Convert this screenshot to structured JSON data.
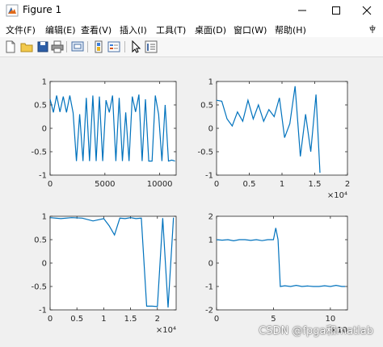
{
  "window": {
    "title": "Figure 1"
  },
  "menu": {
    "items": [
      {
        "label": "文件(F)",
        "underline": "F"
      },
      {
        "label": "编辑(E)",
        "underline": "E"
      },
      {
        "label": "查看(V)",
        "underline": "V"
      },
      {
        "label": "插入(I)",
        "underline": "I"
      },
      {
        "label": "工具(T)",
        "underline": "T"
      },
      {
        "label": "桌面(D)",
        "underline": "D"
      },
      {
        "label": "窗口(W)",
        "underline": "W"
      },
      {
        "label": "帮助(H)",
        "underline": "H"
      }
    ]
  },
  "toolbar": {
    "buttons": [
      "new-figure-icon",
      "open-file-icon",
      "save-icon",
      "print-icon",
      "link-plot-icon",
      "insert-colorbar-icon",
      "insert-legend-icon",
      "select-arrow-icon",
      "property-inspector-icon"
    ]
  },
  "colors": {
    "line": "#0072bd",
    "axes_bg": "#ffffff",
    "figure_bg": "#f0f0f0"
  },
  "chart_data": [
    {
      "type": "line",
      "xlim": [
        0,
        11500
      ],
      "ylim": [
        -1,
        1
      ],
      "xticks": [
        0,
        5000,
        10000
      ],
      "xtick_labels": [
        "0",
        "5000",
        "10000"
      ],
      "yticks": [
        -1,
        -0.5,
        0,
        0.5,
        1
      ],
      "ytick_labels": [
        "-1",
        "-0.5",
        "0",
        "0.5",
        "1"
      ],
      "exponent_label": "",
      "grid": false,
      "series": [
        {
          "x": [
            0,
            300,
            600,
            900,
            1200,
            1500,
            1800,
            2100,
            2400,
            2700,
            3000,
            3300,
            3600,
            3900,
            4200,
            4500,
            4800,
            5100,
            5400,
            5700,
            6000,
            6300,
            6600,
            6900,
            7200,
            7500,
            7800,
            8100,
            8400,
            8700,
            9000,
            9300,
            9600,
            9900,
            10200,
            10500,
            10800,
            11100,
            11400
          ],
          "y": [
            0.62,
            0.34,
            0.7,
            0.35,
            0.68,
            0.34,
            0.7,
            0.33,
            -0.7,
            0.3,
            -0.7,
            0.65,
            -0.7,
            0.7,
            -0.7,
            0.68,
            -0.7,
            0.6,
            0.34,
            0.7,
            -0.7,
            0.65,
            -0.7,
            0.34,
            -0.7,
            0.68,
            0.35,
            0.72,
            -0.7,
            0.62,
            -0.7,
            -0.7,
            0.7,
            0.3,
            -0.7,
            0.5,
            -0.7,
            -0.68,
            -0.7
          ]
        }
      ]
    },
    {
      "type": "line",
      "xlim": [
        0,
        20000
      ],
      "ylim": [
        -1,
        1
      ],
      "xticks": [
        0,
        5000,
        10000,
        15000,
        20000
      ],
      "xtick_labels": [
        "0",
        "0.5",
        "1",
        "1.5",
        "2"
      ],
      "yticks": [
        -1,
        -0.5,
        0,
        0.5,
        1
      ],
      "ytick_labels": [
        "-1",
        "-0.5",
        "0",
        "0.5",
        "1"
      ],
      "exponent_label": "×10⁴",
      "grid": false,
      "series": [
        {
          "x": [
            0,
            800,
            1600,
            2400,
            3200,
            4000,
            4800,
            5600,
            6400,
            7200,
            8000,
            8800,
            9600,
            10400,
            11200,
            12000,
            12800,
            13600,
            14400,
            15200,
            15800
          ],
          "y": [
            0.6,
            0.58,
            0.2,
            0.05,
            0.35,
            0.15,
            0.6,
            0.2,
            0.5,
            0.15,
            0.4,
            0.25,
            0.65,
            -0.2,
            0.1,
            0.9,
            -0.6,
            0.3,
            -0.5,
            0.72,
            -0.95
          ]
        }
      ]
    },
    {
      "type": "line",
      "xlim": [
        0,
        23500
      ],
      "ylim": [
        -1,
        1
      ],
      "xticks": [
        0,
        5000,
        10000,
        15000,
        20000
      ],
      "xtick_labels": [
        "0",
        "0.5",
        "1",
        "1.5",
        "2"
      ],
      "yticks": [
        -1,
        -0.5,
        0,
        0.5,
        1
      ],
      "ytick_labels": [
        "-1",
        "-0.5",
        "0",
        "0.5",
        "1"
      ],
      "exponent_label": "×10⁴",
      "grid": false,
      "series": [
        {
          "x": [
            0,
            2000,
            4000,
            6000,
            8000,
            10000,
            11000,
            12000,
            13000,
            14000,
            15000,
            16000,
            17000,
            18000,
            19000,
            20000,
            21000,
            22000,
            23000
          ],
          "y": [
            0.97,
            0.95,
            0.97,
            0.96,
            0.9,
            0.95,
            0.8,
            0.6,
            0.96,
            0.95,
            0.97,
            0.95,
            0.96,
            -0.92,
            -0.92,
            -0.93,
            0.96,
            -0.95,
            0.97
          ]
        }
      ]
    },
    {
      "type": "line",
      "xlim": [
        0,
        11500
      ],
      "ylim": [
        -2,
        2
      ],
      "xticks": [
        0,
        5000,
        10000
      ],
      "xtick_labels": [
        "0",
        "5",
        "10"
      ],
      "yticks": [
        -2,
        -1,
        0,
        1,
        2
      ],
      "ytick_labels": [
        "-2",
        "-1",
        "0",
        "1",
        "2"
      ],
      "exponent_label": "×10",
      "grid": false,
      "series": [
        {
          "x": [
            0,
            500,
            1000,
            1500,
            2000,
            2500,
            3000,
            3500,
            4000,
            4500,
            5000,
            5200,
            5400,
            5600,
            6000,
            6500,
            7000,
            7500,
            8000,
            8500,
            9000,
            9500,
            10000,
            10500,
            11000,
            11300
          ],
          "y": [
            1.0,
            0.98,
            1.0,
            0.95,
            1.0,
            1.0,
            0.97,
            1.0,
            0.96,
            1.0,
            1.0,
            1.5,
            1.0,
            -1.0,
            -0.97,
            -1.0,
            -0.95,
            -1.0,
            -0.98,
            -1.0,
            -1.0,
            -0.97,
            -1.0,
            -0.95,
            -1.0,
            -1.0
          ]
        }
      ]
    }
  ],
  "watermark": "CSDN @fpga和matlab"
}
